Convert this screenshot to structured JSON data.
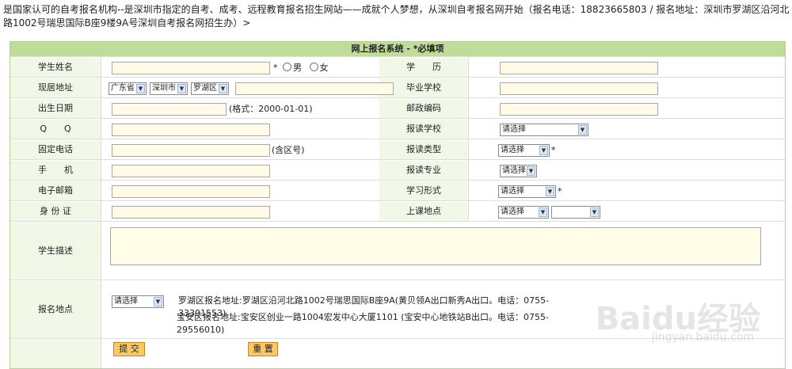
{
  "intro": "是国家认可的自考报名机构--是深圳市指定的自考、成考、远程教育报名招生网站——成就个人梦想，从深圳自考报名网开始（报名电话：18823665803 /    报名地址：深圳市罗湖区沿河北路1002号瑞思国际B座9楼9A号深圳自考报名网招生办）>",
  "form": {
    "title": "网上报名系统 - *必填项",
    "rows": [
      {
        "left_label": "学生姓名",
        "right_label": "学　　历"
      },
      {
        "left_label": "现居地址",
        "right_label": "毕业学校"
      },
      {
        "left_label": "出生日期",
        "right_label": "邮政编码"
      },
      {
        "left_label": "Q　　Q",
        "right_label": "报读学校"
      },
      {
        "left_label": "固定电话",
        "right_label": "报读类型"
      },
      {
        "left_label": "手　　机",
        "right_label": "报读专业"
      },
      {
        "left_label": "电子邮箱",
        "right_label": "学习形式"
      },
      {
        "left_label": "身 份 证",
        "right_label": "上课地点"
      }
    ],
    "desc_label": "学生描述",
    "site_label": "报名地点",
    "asterisk": "*",
    "gender": {
      "male": "男",
      "female": "女"
    },
    "address": {
      "province": "广东省",
      "city": "深圳市",
      "district": "罗湖区"
    },
    "birth_hint": "(格式：2000-01-01)",
    "tel_hint": "(含区号)",
    "select_placeholder": "请选择",
    "site_address_1": "罗湖区报名地址:罗湖区沿河北路1002号瑞思国际B座9A(黄贝领A出口新秀A出口。电话：0755-33391553)",
    "site_address_2": "宝安区报名地址:宝安区创业一路1004宏发中心大厦1101 (宝安中心地铁站B出口。电话：0755-29556010)",
    "submit_label": "提 交",
    "reset_label": "重 置"
  },
  "watermark": {
    "main": "Baidu经验",
    "sub": "jingyan.baidu.com"
  }
}
